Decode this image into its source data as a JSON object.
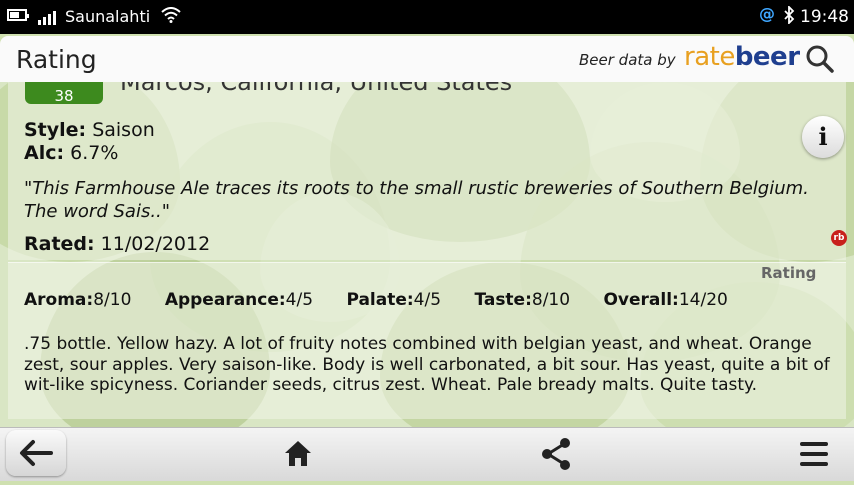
{
  "status_bar": {
    "carrier": "Saunalahti",
    "time": "19:48"
  },
  "header": {
    "title": "Rating",
    "credit_prefix": "Beer data by",
    "brand_rate": "rate",
    "brand_beer": "beer"
  },
  "beer": {
    "score_badge": "38",
    "origin": "Marcos, California, United States",
    "style_label": "Style:",
    "style_value": "Saison",
    "alc_label": "Alc:",
    "alc_value": "6.7%",
    "description": "\"This Farmhouse Ale traces its roots to the small rustic breweries of Southern Belgium. The word Sais..\"",
    "rated_label": "Rated:",
    "rated_value": "11/02/2012",
    "rb_badge": "rb"
  },
  "rating": {
    "section_label": "Rating",
    "scores": [
      {
        "label": "Aroma:",
        "value": "8/10"
      },
      {
        "label": "Appearance:",
        "value": "4/5"
      },
      {
        "label": "Palate:",
        "value": "4/5"
      },
      {
        "label": "Taste:",
        "value": "8/10"
      },
      {
        "label": "Overall:",
        "value": "14/20"
      }
    ],
    "review": ".75 bottle. Yellow hazy. A lot of fruity notes combined with belgian yeast, and wheat. Orange zest, sour apples. Very saison-like. Body is well carbonated, a bit sour. Has yeast, quite a bit of wit-like spicyness. Coriander seeds, citrus zest. Wheat. Pale bready malts. Quite tasty."
  },
  "icons": {
    "info": "info-icon",
    "search": "search-icon",
    "back": "back-arrow-icon",
    "home": "home-icon",
    "share": "share-icon",
    "menu": "menu-icon"
  }
}
